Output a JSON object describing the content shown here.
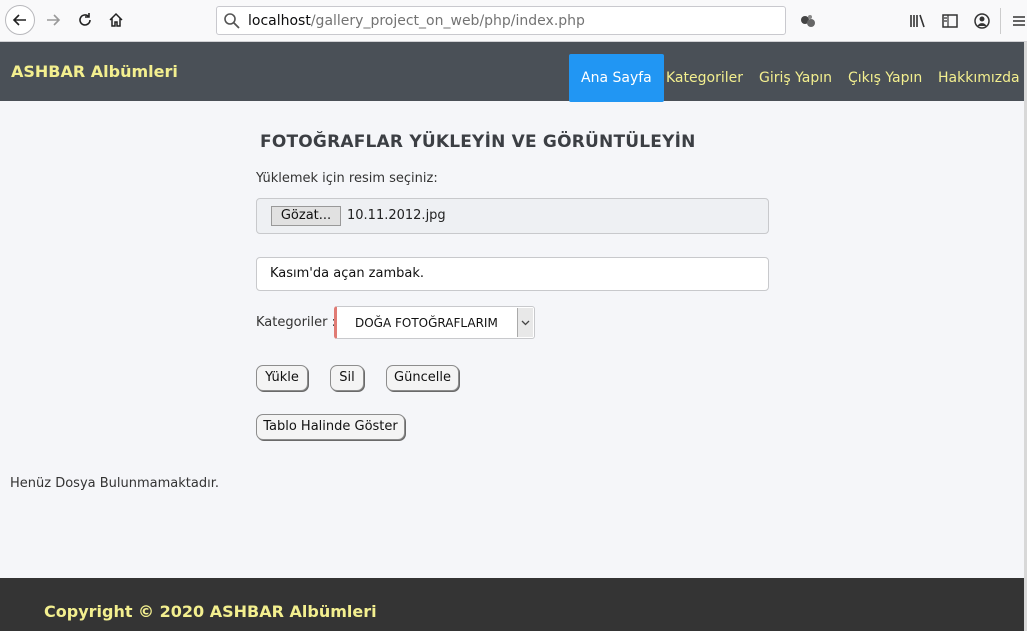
{
  "browser": {
    "url_host": "localhost",
    "url_path": "/gallery_project_on_web/php/index.php"
  },
  "navbar": {
    "brand": "ASHBAR Albümleri",
    "links": [
      {
        "label": "Ana Sayfa",
        "active": true
      },
      {
        "label": "Kategoriler",
        "active": false
      },
      {
        "label": "Giriş Yapın",
        "active": false
      },
      {
        "label": "Çıkış Yapın",
        "active": false
      },
      {
        "label": "Hakkımızda",
        "active": false
      }
    ],
    "active_color": "#2196f3",
    "link_color": "#f3ef8f"
  },
  "main": {
    "title": "FOTOĞRAFLAR YÜKLEYİN VE GÖRÜNTÜLEYİN",
    "file_label": "Yüklemek için resim seçiniz:",
    "file_button": "Gözat...",
    "file_name": "10.11.2012.jpg",
    "description_value": "Kasım'da açan zambak.",
    "category_label": "Kategoriler :",
    "category_selected": "DOĞA FOTOĞRAFLARIM",
    "buttons": {
      "upload": "Yükle",
      "delete": "Sil",
      "update": "Güncelle",
      "table": "Tablo Halinde Göster"
    },
    "empty_message": "Henüz Dosya Bulunmamaktadır."
  },
  "footer": {
    "copyright": "Copyright © 2020 ASHBAR Albümleri"
  },
  "icons": [
    "back-arrow-icon",
    "forward-arrow-icon",
    "reload-icon",
    "home-icon",
    "search-icon",
    "extension-icon",
    "library-icon",
    "sidebar-icon",
    "account-icon",
    "hamburger-menu-icon",
    "chevron-down-icon"
  ]
}
